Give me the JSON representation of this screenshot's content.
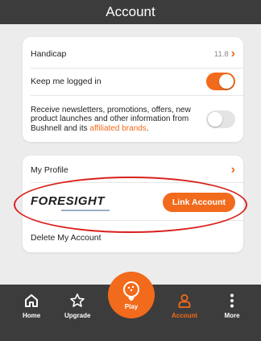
{
  "header": {
    "title": "Account"
  },
  "settings": {
    "handicap_label": "Handicap",
    "handicap_value": "11.8",
    "keep_logged_in_label": "Keep me logged in",
    "keep_logged_in_on": true,
    "newsletter_text": "Receive newsletters, promotions, offers, new product launches and other information from Bushnell and its ",
    "newsletter_link": "affiliated brands",
    "newsletter_period": ".",
    "newsletter_on": false
  },
  "profile": {
    "my_profile_label": "My Profile",
    "foresight_logo": "FORESIGHT",
    "link_account_label": "Link Account",
    "delete_account_label": "Delete My Account"
  },
  "nav": {
    "home": "Home",
    "upgrade": "Upgrade",
    "play": "Play",
    "account": "Account",
    "more": "More"
  },
  "colors": {
    "accent": "#f26a1b",
    "header_bg": "#3c3c3c",
    "annotation_red": "#d9201c"
  }
}
